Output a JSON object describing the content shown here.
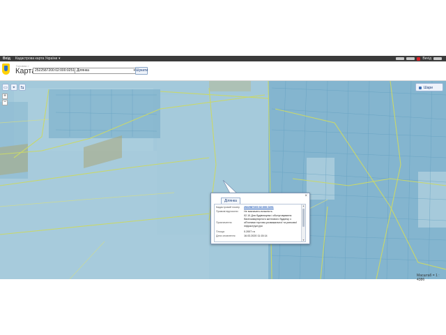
{
  "topbar": {
    "brand": "Вхiд",
    "site": "Кадастрова карта України",
    "menu_caret": "▾",
    "user_label": "Вихід"
  },
  "header": {
    "breadcrumb": "Головна >",
    "title": "Карта"
  },
  "search": {
    "value": "2522587200:02:000:0251",
    "type_value": "Ділянка",
    "type_chevron": "▾",
    "button_label": "Шукати"
  },
  "map_tools": {
    "tool1": "▭",
    "tool2": "⌖",
    "tool3": "⇆",
    "zoom_in": "+",
    "zoom_out": "−",
    "layers_label": "Шари",
    "scale_text": "Масштаб = 1 : 4386"
  },
  "popup": {
    "tab_label": "Ділянка",
    "close": "×",
    "scroll_up": "▲",
    "scroll_down": "▼",
    "rows": [
      {
        "key": "Кадастровий номер",
        "value": "2522587200:02:000:0251"
      },
      {
        "key": "Правові відносини",
        "value": "Не визначено власність"
      },
      {
        "key": "Призначення",
        "value": "02.10 Для будівництва і обслуговування багатоквартирного житлового будинку з об'єктами торгово-розважальної та ринкової інфраструктури"
      },
      {
        "key": "Площа",
        "value": "0.2007 га"
      },
      {
        "key": "Дата оновлення",
        "value": "16.03.2020 11:15:14"
      }
    ]
  },
  "colors": {
    "map_parcel": "#9ec6d8",
    "boundary": "#c7d86a",
    "popup_border": "#7d95b5"
  }
}
